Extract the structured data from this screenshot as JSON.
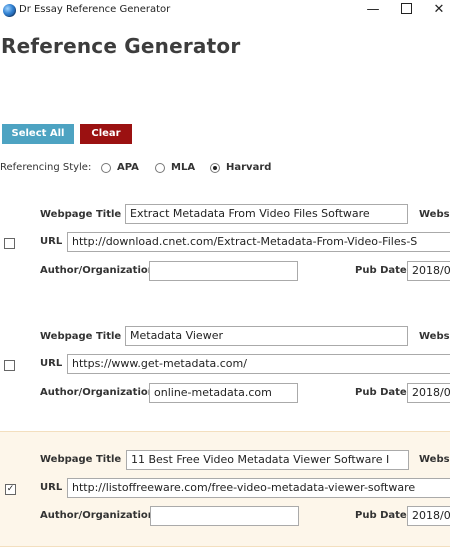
{
  "window": {
    "title": "Dr Essay Reference Generator",
    "minimize": "—",
    "close": "✕"
  },
  "page_title": "Reference Generator",
  "toolbar": {
    "select_all": "Select All",
    "clear": "Clear"
  },
  "style": {
    "label": "Referencing Style:",
    "options": [
      {
        "label": "APA",
        "checked": false
      },
      {
        "label": "MLA",
        "checked": false
      },
      {
        "label": "Harvard",
        "checked": true
      }
    ]
  },
  "labels": {
    "webpage_title": "Webpage Title",
    "website": "Websit",
    "url": "URL",
    "author": "Author/Organization",
    "pub_date": "Pub Date"
  },
  "entries": [
    {
      "checked": false,
      "webpage_title": "Extract Metadata From Video Files Software",
      "url": "http://download.cnet.com/Extract-Metadata-From-Video-Files-S",
      "author": "",
      "pub_date": "2018/0"
    },
    {
      "checked": false,
      "webpage_title": "Metadata Viewer",
      "url": "https://www.get-metadata.com/",
      "author": "online-metadata.com",
      "pub_date": "2018/0"
    },
    {
      "checked": true,
      "webpage_title": "11 Best Free Video Metadata Viewer Software I",
      "url": "http://listoffreeware.com/free-video-metadata-viewer-software",
      "author": "",
      "pub_date": "2018/0"
    }
  ]
}
